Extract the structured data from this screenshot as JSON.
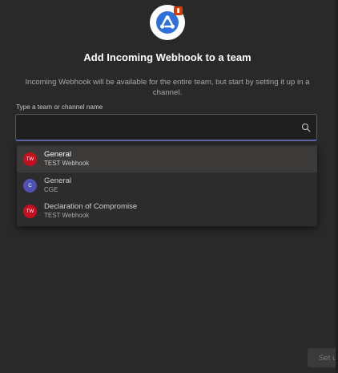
{
  "dialog": {
    "title": "Add Incoming Webhook to a team",
    "description": "Incoming Webhook will be available for the entire team, but start by setting it up in a channel.",
    "field_label": "Type a team or channel name",
    "search": {
      "value": "",
      "placeholder": ""
    },
    "logo_icon": "webhook-icon",
    "search_icon": "search-icon"
  },
  "options": [
    {
      "avatar_text": "TW",
      "avatar_color": "#c50f1f",
      "name": "General",
      "team": "TEST Webhook"
    },
    {
      "avatar_text": "C",
      "avatar_color": "#4f52b2",
      "name": "General",
      "team": "CGE"
    },
    {
      "avatar_text": "TW",
      "avatar_color": "#c50f1f",
      "name": "Declaration of Compromise",
      "team": "TEST Webhook"
    }
  ],
  "footer": {
    "setup_label": "Set up"
  },
  "colors": {
    "background": "#292929",
    "accent": "#6264a7",
    "highlight": "#3b3a39"
  }
}
